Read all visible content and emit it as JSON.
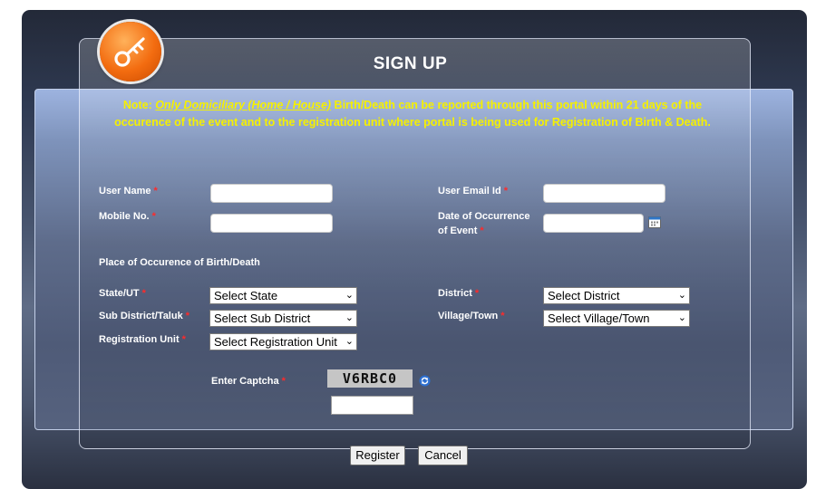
{
  "header": {
    "title": "SIGN UP"
  },
  "note": {
    "prefix": "Note: ",
    "underlined": "Only Domiciliary (Home / House)",
    "text": " Birth/Death can be reported through this portal within 21 days of the occurence of the event and to the registration unit where portal is being used for Registration of Birth & Death."
  },
  "form": {
    "username_label": "User Name",
    "email_label": "User Email Id",
    "mobile_label": "Mobile No.",
    "date_label_line1": "Date of Occurrence",
    "date_label_line2": "of Event",
    "required_mark": "*",
    "place_heading": "Place of Occurence of Birth/Death",
    "state_label": "State/UT",
    "district_label": "District",
    "subdistrict_label": "Sub District/Taluk",
    "village_label": "Village/Town",
    "regunit_label": "Registration Unit",
    "state_value": "Select State",
    "district_value": "Select District",
    "subdistrict_value": "Select Sub District",
    "village_value": "Select Village/Town",
    "regunit_value": "Select Registration Unit",
    "captcha_label": "Enter Captcha",
    "captcha_code": "V6RBC0"
  },
  "buttons": {
    "register": "Register",
    "cancel": "Cancel"
  },
  "icons": {
    "badge": "key-icon",
    "calendar": "calendar-icon",
    "refresh": "refresh-icon",
    "dropdown": "chevron-down-icon"
  },
  "colors": {
    "note": "#f5f000",
    "required": "#ff2a2a",
    "badge": "#f36c10"
  }
}
